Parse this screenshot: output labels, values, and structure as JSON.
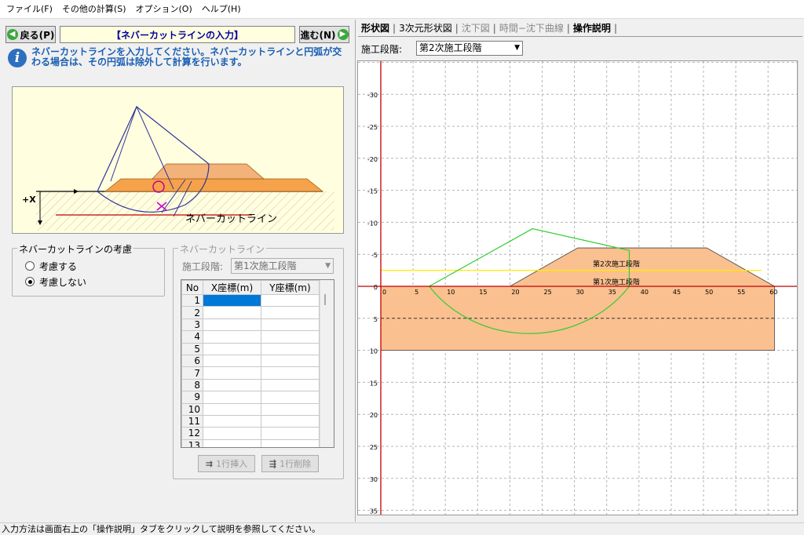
{
  "menu": [
    "ファイル(F)",
    "その他の計算(S)",
    "オプション(O)",
    "ヘルプ(H)"
  ],
  "nav": {
    "back_label": "戻る(P)",
    "title": "【ネバーカットラインの入力】",
    "next_label": "進む(N)"
  },
  "info": {
    "text": "ネバーカットラインを入力してください。ネバーカットラインと円弧が交わる場合は、その円弧は除外して計算を行います。"
  },
  "diagram": {
    "axis_label": "+X",
    "line_label": "ネバーカットライン"
  },
  "consider": {
    "title": "ネバーカットラインの考慮",
    "options": [
      "考慮する",
      "考慮しない"
    ],
    "selected": "考慮しない"
  },
  "nc": {
    "title": "ネバーカットライン",
    "stage_label": "施工段階:",
    "stage_value": "第1次施工段階",
    "columns": [
      "No",
      "X座標(m)",
      "Y座標(m)"
    ],
    "rows": [
      "1",
      "2",
      "3",
      "4",
      "5",
      "6",
      "7",
      "8",
      "9",
      "10",
      "11",
      "12",
      "13"
    ],
    "insert_label": "1行挿入",
    "delete_label": "1行削除"
  },
  "tabs": [
    "形状図",
    "3次元形状図",
    "沈下図",
    "時間−沈下曲線",
    "操作説明"
  ],
  "active_tab": "形状図",
  "stage": {
    "label": "施工段階:",
    "value": "第2次施工段階"
  },
  "chart": {
    "x_ticks": [
      "0",
      "5",
      "10",
      "15",
      "20",
      "25",
      "30",
      "35",
      "40",
      "45",
      "50",
      "55",
      "60"
    ],
    "y_ticks": [
      "-30",
      "-25",
      "-20",
      "-15",
      "-10",
      "-5",
      "0",
      "5",
      "10",
      "15",
      "20",
      "25",
      "30",
      "35"
    ],
    "stage_labels": [
      "第2次施工段階",
      "第1次施工段階"
    ],
    "colors": {
      "fill": "#fac08f",
      "ground_line": "#c00000",
      "slip": "#33cc33",
      "water": "#ffee00",
      "grid": "#b4b4b4"
    }
  },
  "status": "入力方法は画面右上の「操作説明」タブをクリックして説明を参照してください。"
}
